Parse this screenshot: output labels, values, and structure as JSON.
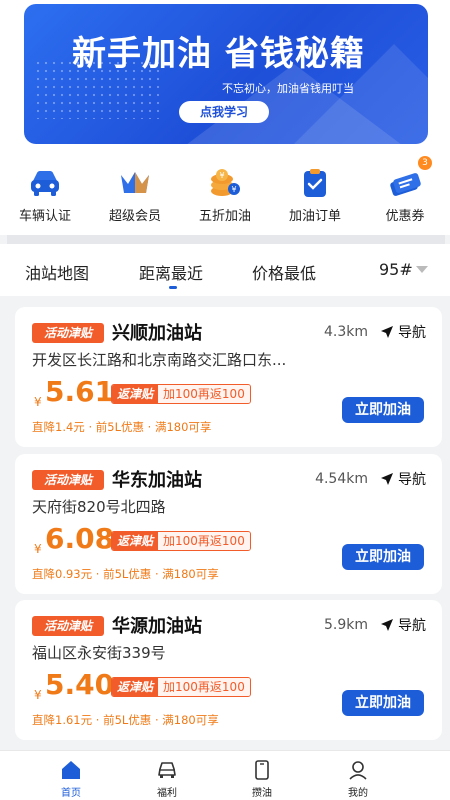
{
  "banner": {
    "title": "新手加油 省钱秘籍",
    "subtitle": "不忘初心，加油省钱用叮当",
    "button": "点我学习"
  },
  "quick_menu": [
    {
      "label": "车辆认证",
      "icon": "car-icon"
    },
    {
      "label": "超级会员",
      "icon": "crown-icon"
    },
    {
      "label": "五折加油",
      "icon": "coin-stack-icon"
    },
    {
      "label": "加油订单",
      "icon": "order-icon"
    },
    {
      "label": "优惠券",
      "icon": "coupon-icon",
      "badge": "3"
    }
  ],
  "tabs": {
    "map": "油站地图",
    "nearest": "距离最近",
    "cheapest": "价格最低",
    "fuel": "95#",
    "active": "nearest"
  },
  "stations": [
    {
      "tag": "活动津贴",
      "name": "兴顺加油站",
      "distance": "4.3km",
      "nav": "导航",
      "address": "开发区长江路和北京南路交汇路口东...",
      "currency": "¥",
      "price": "5.61",
      "rebate_tag": "返津贴",
      "rebate_text": "加100再返100",
      "discount": "直降1.4元 · 前5L优惠 · 满180可享",
      "button": "立即加油"
    },
    {
      "tag": "活动津贴",
      "name": "华东加油站",
      "distance": "4.54km",
      "nav": "导航",
      "address": "天府街820号北四路",
      "currency": "¥",
      "price": "6.08",
      "rebate_tag": "返津贴",
      "rebate_text": "加100再返100",
      "discount": "直降0.93元 · 前5L优惠 · 满180可享",
      "button": "立即加油"
    },
    {
      "tag": "活动津贴",
      "name": "华源加油站",
      "distance": "5.9km",
      "nav": "导航",
      "address": "福山区永安街339号",
      "currency": "¥",
      "price": "5.40",
      "rebate_tag": "返津贴",
      "rebate_text": "加100再返100",
      "discount": "直降1.61元 · 前5L优惠 · 满180可享",
      "button": "立即加油"
    }
  ],
  "bottom_nav": [
    {
      "label": "首页",
      "icon": "home-icon",
      "active": true
    },
    {
      "label": "福利",
      "icon": "car-front-icon"
    },
    {
      "label": "攒油",
      "icon": "phone-icon"
    },
    {
      "label": "我的",
      "icon": "user-icon"
    }
  ],
  "colors": {
    "primary": "#1d5dd8",
    "accent": "#f07a17",
    "tag": "#f25c2a"
  }
}
